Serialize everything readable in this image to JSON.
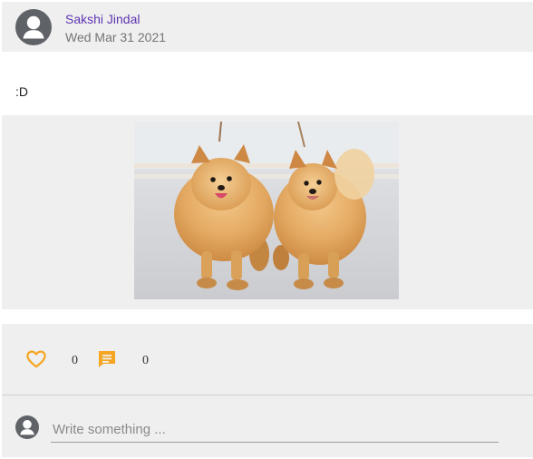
{
  "post": {
    "author": "Sakshi Jindal",
    "date": "Wed Mar 31 2021",
    "text": ":D",
    "avatar_icon": "user-avatar-icon",
    "image_alt": "Two fluffy Pomeranian dogs on leashes"
  },
  "actions": {
    "like_icon": "heart-outline-icon",
    "like_count": "0",
    "comment_icon": "comment-icon",
    "comment_count": "0"
  },
  "comment_box": {
    "placeholder": "Write something ...",
    "value": "",
    "avatar_icon": "user-avatar-icon"
  },
  "colors": {
    "author_name": "#5e35b1",
    "accent": "#f5a623",
    "avatar": "#5f6368",
    "surface": "#efefef"
  }
}
